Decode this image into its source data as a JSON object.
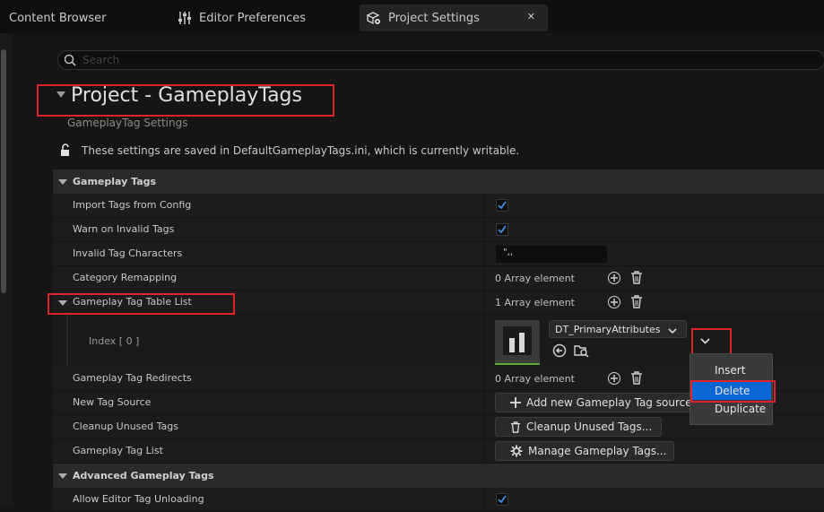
{
  "tabs": [
    {
      "label": "Content Browser",
      "icon": "folder-icon",
      "active": false
    },
    {
      "label": "Editor Preferences",
      "icon": "sliders-icon",
      "active": false
    },
    {
      "label": "Project Settings",
      "icon": "settings-cube-icon",
      "active": true
    }
  ],
  "tab_close_glyph": "✕",
  "search": {
    "placeholder": "Search"
  },
  "header": {
    "title": "Project - GameplayTags",
    "subtitle": "GameplayTag Settings",
    "notice": "These settings are saved in DefaultGameplayTags.ini, which is currently writable."
  },
  "sections": {
    "gameplay_tags": "Gameplay Tags",
    "advanced": "Advanced Gameplay Tags"
  },
  "rows": {
    "import_tags": {
      "label": "Import Tags from Config",
      "checked": true
    },
    "warn_invalid": {
      "label": "Warn on Invalid Tags",
      "checked": true
    },
    "invalid_chars": {
      "label": "Invalid Tag Characters",
      "value": "\",,"
    },
    "category_remap": {
      "label": "Category Remapping",
      "count": "0 Array element"
    },
    "table_list": {
      "label": "Gameplay Tag Table List",
      "count": "1 Array element"
    },
    "index0": {
      "label": "Index [ 0 ]",
      "asset": "DT_PrimaryAttributes"
    },
    "redirects": {
      "label": "Gameplay Tag Redirects",
      "count": "0 Array element"
    },
    "new_source": {
      "label": "New Tag Source",
      "button": "Add new Gameplay Tag source..."
    },
    "cleanup": {
      "label": "Cleanup Unused Tags",
      "button": "Cleanup Unused Tags..."
    },
    "tag_list": {
      "label": "Gameplay Tag List",
      "button": "Manage Gameplay Tags..."
    },
    "allow_unload": {
      "label": "Allow Editor Tag Unloading",
      "checked": true
    }
  },
  "context_menu": {
    "items": [
      "Insert",
      "Delete",
      "Duplicate"
    ],
    "selected": "Delete"
  },
  "colors": {
    "accent": "#0a66d2",
    "highlight_box": "#e0222a",
    "check": "#3d8fe6"
  }
}
